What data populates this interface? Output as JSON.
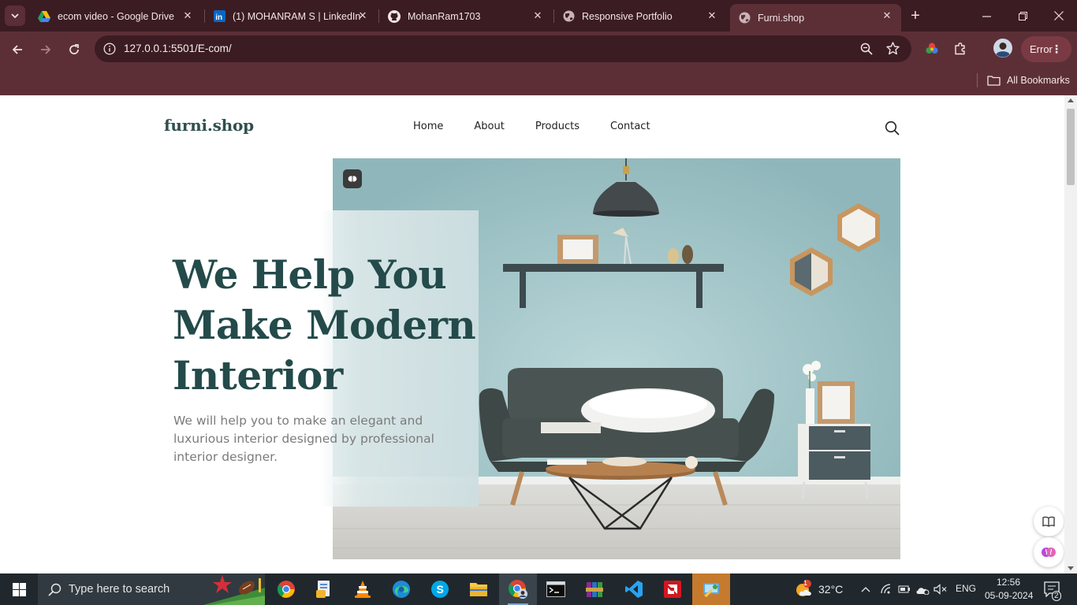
{
  "browser": {
    "tabs": [
      {
        "title": "ecom video - Google Drive",
        "icon": "google-drive-icon"
      },
      {
        "title": "(1) MOHANRAM S | LinkedIn",
        "icon": "linkedin-icon"
      },
      {
        "title": "MohanRam1703",
        "icon": "github-icon"
      },
      {
        "title": "Responsive Portfolio",
        "icon": "globe-icon"
      },
      {
        "title": "Furni.shop",
        "icon": "globe-icon",
        "active": true
      }
    ],
    "url": "127.0.0.1:5501/E-com/",
    "profile_status": "Error",
    "bookmarks_label": "All Bookmarks",
    "theme_color": "#5c2f37"
  },
  "site": {
    "logo": "furni.shop",
    "nav": [
      "Home",
      "About",
      "Products",
      "Contact"
    ],
    "hero": {
      "title": "We Help You Make Modern Interior",
      "subtitle": "We will help you to make an elegant and luxurious interior designed by professional interior designer."
    },
    "accent_color": "#244a4a"
  },
  "taskbar": {
    "search_placeholder": "Type here to search",
    "weather": "32°C",
    "weather_badge": "1",
    "language": "ENG",
    "time": "12:56",
    "date": "05-09-2024",
    "notifications": "2"
  }
}
